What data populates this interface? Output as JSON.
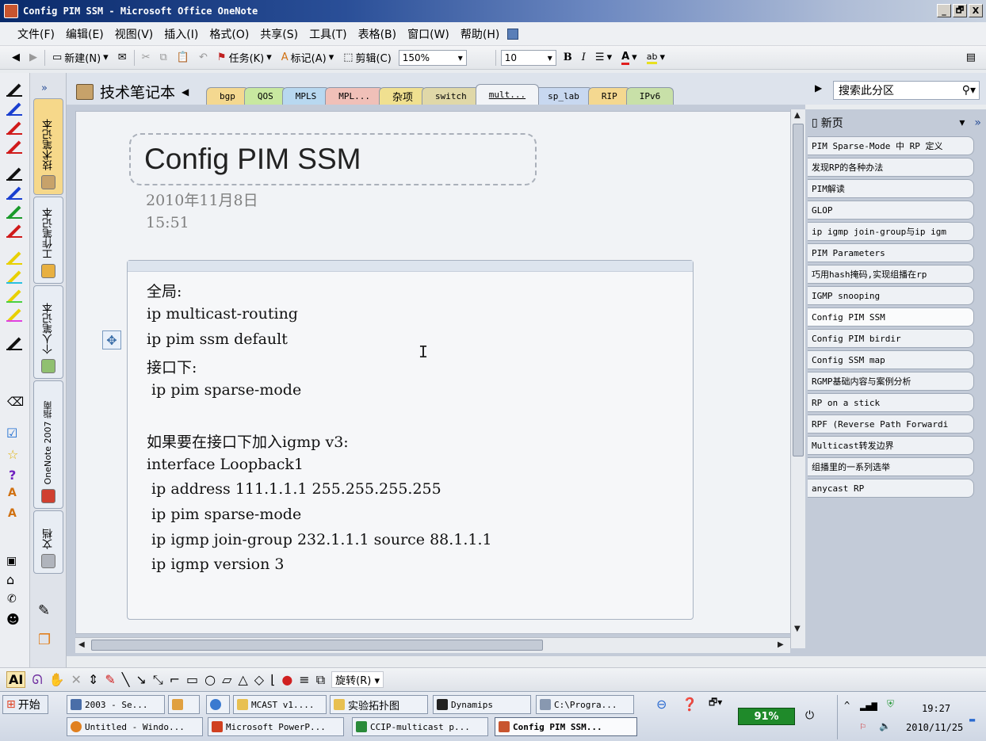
{
  "window": {
    "title": "Config PIM SSM - Microsoft Office OneNote",
    "controls": [
      "_",
      "🗗",
      "X"
    ]
  },
  "menu": [
    "文件(F)",
    "编辑(E)",
    "视图(V)",
    "插入(I)",
    "格式(O)",
    "共享(S)",
    "工具(T)",
    "表格(B)",
    "窗口(W)",
    "帮助(H)"
  ],
  "toolbar": {
    "new_label": "新建(N)",
    "task_label": "任务(K)",
    "tag_label": "标记(A)",
    "clip_label": "剪辑(C)",
    "zoom_value": "150%",
    "font_size": "10",
    "bold": "B",
    "italic": "I"
  },
  "notebook": {
    "title": "技术笔记本",
    "side_tabs": [
      "技术笔记本",
      "工作笔记本",
      "个人笔记本",
      "OneNote 2007 指南",
      "文档"
    ],
    "section_tabs": [
      "bgp",
      "QOS",
      "MPLS",
      "MPL...",
      "杂项",
      "switch",
      "mult...",
      "sp_lab",
      "RIP",
      "IPv6"
    ],
    "active_section": "mult...",
    "search_placeholder": "搜索此分区"
  },
  "page": {
    "title": "Config PIM SSM",
    "date": "2010年11月8日",
    "time": "15:51",
    "content_lines": [
      "全局:",
      "ip multicast-routing",
      "ip pim ssm default",
      "接口下:",
      " ip pim sparse-mode",
      "",
      "如果要在接口下加入igmp v3:",
      "interface Loopback1",
      " ip address 111.1.1.1 255.255.255.255",
      " ip pim sparse-mode",
      " ip igmp join-group 232.1.1.1 source 88.1.1.1",
      " ip igmp version 3"
    ]
  },
  "page_list": {
    "new_page_label": "新页",
    "items": [
      "PIM Sparse-Mode 中 RP 定义",
      "发现RP的各种办法",
      "PIM解读",
      "GLOP",
      "ip igmp join-group与ip igm",
      "PIM Parameters",
      "巧用hash掩码,实现组播在rp",
      "IGMP snooping",
      "Config PIM SSM",
      "Config PIM birdir",
      "Config SSM map",
      "RGMP基础内容与案例分析",
      "RP on a stick",
      "RPF (Reverse Path Forwardi",
      "Multicast转发边界",
      "组播里的一系列选举",
      "anycast RP"
    ],
    "active_item": "Config PIM SSM"
  },
  "drawbar": {
    "rotate_label": "旋转(R)"
  },
  "taskbar": {
    "start_label": "开始",
    "row1": [
      "2003 - Se...",
      "",
      "",
      "MCAST v1....",
      "实验拓扑图",
      "Dynamips",
      "C:\\Progra..."
    ],
    "row2": [
      "Untitled - Windo...",
      "Microsoft PowerP...",
      "CCIP-multicast p...",
      "Config PIM SSM..."
    ],
    "active_task": "Config PIM SSM...",
    "battery": "91%",
    "clock_time": "19:27",
    "clock_date": "2010/11/25"
  },
  "colors": {
    "title_gradient_start": "#0a2a6a",
    "page_bg": "#f1f3f6",
    "accent": "#2a4f98",
    "battery": "#1f8a2a"
  }
}
